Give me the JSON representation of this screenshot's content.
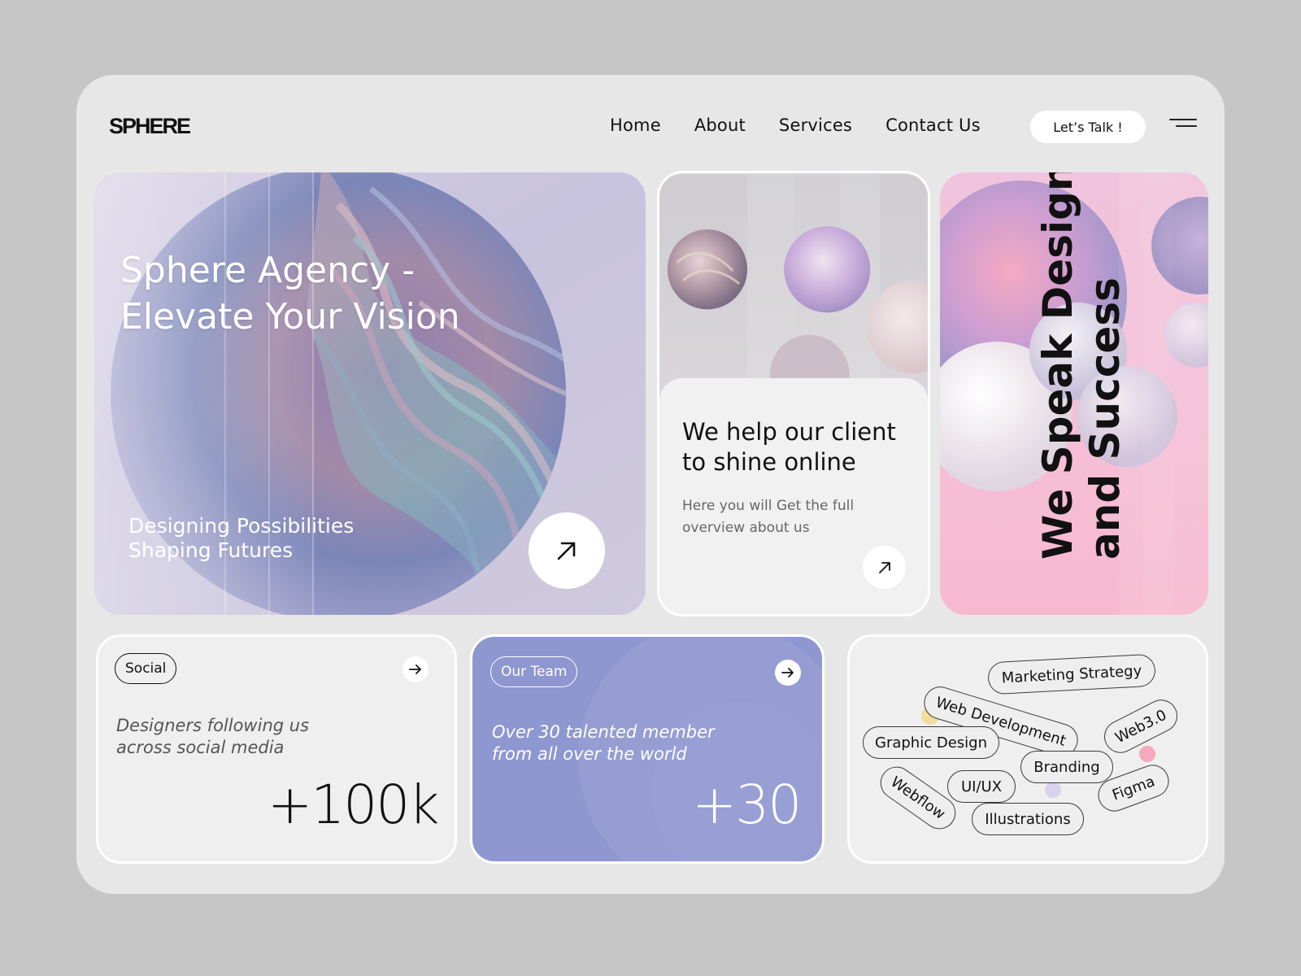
{
  "brand": {
    "logo": "SPHERE"
  },
  "nav": {
    "items": [
      {
        "label": "Home"
      },
      {
        "label": "About"
      },
      {
        "label": "Services"
      },
      {
        "label": "Contact Us"
      }
    ],
    "cta_label": "Let’s Talk !"
  },
  "hero": {
    "title_line1": "Sphere Agency -",
    "title_line2": "Elevate Your Vision",
    "subtitle_line1": "Designing Possibilities",
    "subtitle_line2": "Shaping Futures"
  },
  "info_card": {
    "title_line1": "We help our client",
    "title_line2": "to shine online",
    "text_line1": "Here you will Get the full",
    "text_line2": "overview about us"
  },
  "pink_card": {
    "line1": "We Speak Design",
    "line2": "and Success"
  },
  "social_card": {
    "pill": "Social",
    "desc_line1": "Designers following us",
    "desc_line2": "across social media",
    "count": "+100k"
  },
  "team_card": {
    "pill": "Our Team",
    "desc_line1": "Over 30 talented member",
    "desc_line2": "from all over the world",
    "count": "+30"
  },
  "services_tags": [
    "Marketing Strategy",
    "Web Development",
    "Web3.0",
    "Graphic Design",
    "Branding",
    "UI/UX",
    "Webflow",
    "Figma",
    "Illustrations"
  ],
  "colors": {
    "background": "#c6c6c6",
    "frame": "#e7e7e7",
    "team_card": "#8e97cf",
    "pink_card": "#f5bfd7",
    "dot_yellow": "#f2dd9c",
    "dot_pink": "#f6a9bd",
    "dot_lavender": "#d8d2ee"
  },
  "icons": [
    "menu-icon",
    "arrow-up-right-icon",
    "arrow-right-icon"
  ]
}
